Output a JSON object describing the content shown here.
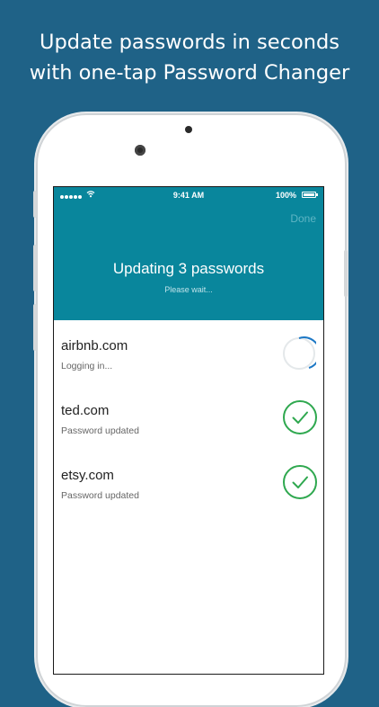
{
  "headline": {
    "line1": "Update passwords in seconds",
    "line2": "with one-tap Password Changer"
  },
  "status_bar": {
    "time": "9:41 AM",
    "battery": "100%",
    "icons": [
      "signal-dots-icon",
      "wifi-icon",
      "battery-icon"
    ]
  },
  "nav": {
    "done_label": "Done"
  },
  "header": {
    "title": "Updating 3 passwords",
    "subtitle": "Please wait..."
  },
  "sites": [
    {
      "name": "airbnb.com",
      "status": "Logging in...",
      "state": "in-progress",
      "icon": "spinner-icon"
    },
    {
      "name": "ted.com",
      "status": "Password updated",
      "state": "done",
      "icon": "check-circle-icon"
    },
    {
      "name": "etsy.com",
      "status": "Password updated",
      "state": "done",
      "icon": "check-circle-icon"
    }
  ],
  "colors": {
    "background": "#1f6287",
    "header": "#09869c",
    "success": "#2fa84f",
    "spinner": "#1d78c5"
  }
}
